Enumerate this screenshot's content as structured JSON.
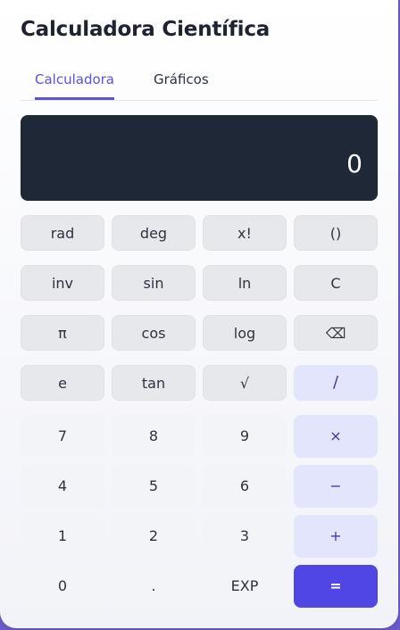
{
  "app": {
    "title": "Calculadora Científica"
  },
  "tabs": [
    {
      "label": "Calculadora",
      "active": true
    },
    {
      "label": "Gráficos",
      "active": false
    }
  ],
  "display": {
    "value": "0"
  },
  "keys": {
    "row1": [
      "rad",
      "deg",
      "x!",
      "()"
    ],
    "row2": [
      "inv",
      "sin",
      "ln",
      "C"
    ],
    "row3": [
      "π",
      "cos",
      "log",
      "⌫"
    ],
    "row4": [
      "e",
      "tan",
      "√",
      "/"
    ],
    "row5": [
      "7",
      "8",
      "9",
      "×"
    ],
    "row6": [
      "4",
      "5",
      "6",
      "−"
    ],
    "row7": [
      "1",
      "2",
      "3",
      "+"
    ],
    "row8": [
      "0",
      ".",
      "EXP",
      "="
    ]
  },
  "colors": {
    "accent": "#5b54d6",
    "display_bg": "#1f2837",
    "equals_bg": "#4f46e5",
    "operator_bg": "#e2e5fb",
    "function_bg": "#e7e8ec"
  }
}
